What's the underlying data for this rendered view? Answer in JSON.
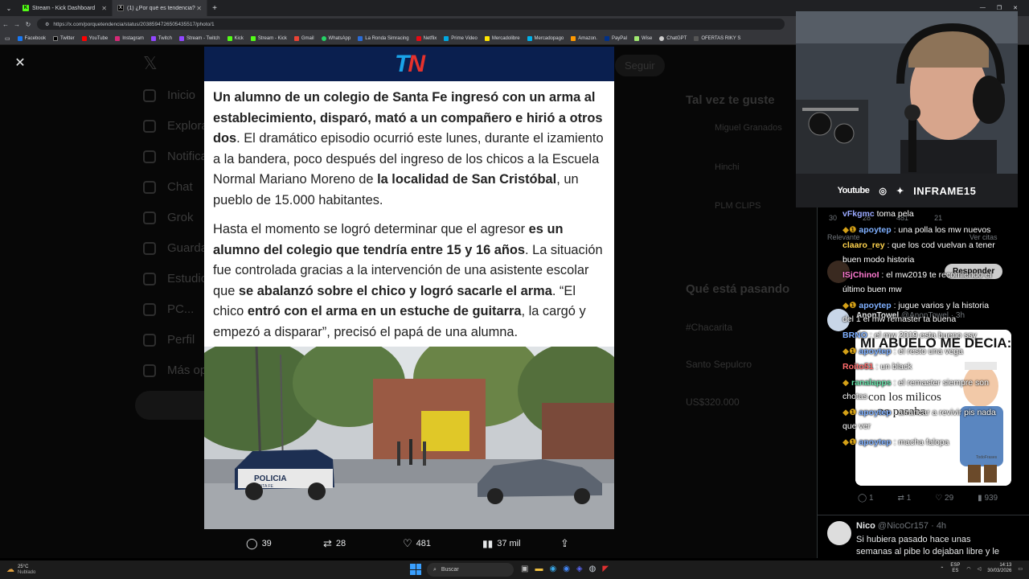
{
  "tabs": [
    {
      "label": "Stream - Kick Dashboard",
      "active": false
    },
    {
      "label": "(1) ¿Por qué es tendencia? (@por...",
      "active": true
    }
  ],
  "new_tab_symbol": "+",
  "url": "https://x.com/porquetendencia/status/2038594726505435517/photo/1",
  "bookmarks": [
    "Facebook",
    "Twitter",
    "YouTube",
    "Instagram",
    "Twitch",
    "Stream - Twitch",
    "Kick",
    "Stream - Kick",
    "Gmail",
    "WhatsApp",
    "La Ronda Simracing",
    "Netflix",
    "Prime Video",
    "Mercadolibre",
    "Mercadopago",
    "Amazon.",
    "PayPal",
    "Wise",
    "ChatGPT",
    "OFERTAS RIKY S"
  ],
  "x_sidebar": [
    "Inicio",
    "Explorar",
    "Notificaciones",
    "Chat",
    "Grok",
    "Guardados",
    "Estudio",
    "PC...",
    "Perfil",
    "Más opciones"
  ],
  "x_right": {
    "may_like": "Tal vez te guste",
    "who1": "Miguel Granados",
    "who2": "Hinchi",
    "who3": "PLM CLIPS",
    "trending": "Qué está pasando",
    "t1": "#Chacarita",
    "t2": "Santo Sepulcro",
    "t3": "US$320.000",
    "relevant": "Relevante",
    "see_quotes": "Ver citas",
    "reply": "Responder",
    "follow": "Seguir"
  },
  "article": {
    "p1_bold": "Un alumno de un colegio de Santa Fe ingresó con un arma al establecimiento, disparó, mató a un compañero e hirió a otros dos",
    "p1_a": ". El dramático episodio ocurrió este lunes, durante el izamiento a la bandera, poco después del ingreso de los chicos a la Escuela Normal Mariano Moreno de ",
    "p1_bold2": "la localidad de San Cristóbal",
    "p1_b": ", un pueblo de 15.000 habitantes.",
    "p2_a": "Hasta el momento se logró determinar que el agresor ",
    "p2_bold": "es un alumno del colegio que tendría entre 15 y 16 años",
    "p2_b": ". La situación fue controlada gracias a la intervención de una asistente escolar que ",
    "p2_bold2": "se abalanzó sobre el chico y logró sacarle el arma",
    "p2_c": ". “El chico ",
    "p2_bold3": "entró con el arma en un estuche de guitarra",
    "p2_d": ", la cargó y empezó a disparar”, precisó el papá de una alumna.",
    "police_text": "POLICIA",
    "police_sub": "SANTA FE"
  },
  "actions": {
    "replies": "39",
    "reposts": "28",
    "likes": "481",
    "views": "37 mil"
  },
  "right_stats": {
    "replies": "30",
    "reposts": "28",
    "likes": "481",
    "views": "21"
  },
  "webcam": {
    "youtube": "Youtube",
    "name": "INFRAME15"
  },
  "chat": [
    {
      "user": "vFkgmc",
      "msg": " toma pela"
    },
    {
      "user": "apoytep",
      "msg": " : una polla los mw nuevos"
    },
    {
      "user": "claaro_rey",
      "msg": " : que los cod vuelvan a tener"
    },
    {
      "user": "",
      "msg": "buen modo historia"
    },
    {
      "user": "ISjChinoI",
      "msg": " : el mw2019 te recomiendo el"
    },
    {
      "user": "",
      "msg": "último buen mw"
    },
    {
      "user": "apoytep",
      "msg": " : jugue varios y la historia"
    },
    {
      "user": "",
      "msg": "del 1 el mw remaster ta buena"
    },
    {
      "user": "BRNO",
      "msg": " : el mw 2019 esta bueno ssy"
    },
    {
      "user": "apoytep",
      "msg": " : el resto una vega"
    },
    {
      "user": "Roito51",
      "msg": " : un black"
    },
    {
      "user": "ranalapps",
      "msg": " : el remaster siempre son"
    },
    {
      "user": "",
      "msg": "chotas"
    },
    {
      "user": "apoytep",
      "msg": " : arrancar a revivir pis nada"
    },
    {
      "user": "",
      "msg": "que ver"
    },
    {
      "user": "apoytep",
      "msg": " : macha falopa"
    }
  ],
  "tweet2": {
    "name": "Nico",
    "handle": "@NicoCr157 · 4h",
    "text1": "Si hubiera pasado hace unas",
    "text2": "semanas al pibe lo dejaban libre y le",
    "user3": "AnonTowel",
    "handle3": "@AnonTowel · 3h"
  },
  "meme": {
    "top": "MI ABUELO ME DECIA:",
    "bottom1": "con los milicos",
    "bottom2": "no pasaba",
    "credit": "TodoFrases"
  },
  "tweet1_stats": {
    "replies": "1",
    "reposts": "1",
    "likes": "29",
    "views": "939"
  },
  "taskbar": {
    "temp": "25°C",
    "weather": "Nublado",
    "search": "Buscar",
    "lang1": "ESP",
    "lang2": "ES",
    "time": "14:13",
    "date": "30/03/2026"
  }
}
